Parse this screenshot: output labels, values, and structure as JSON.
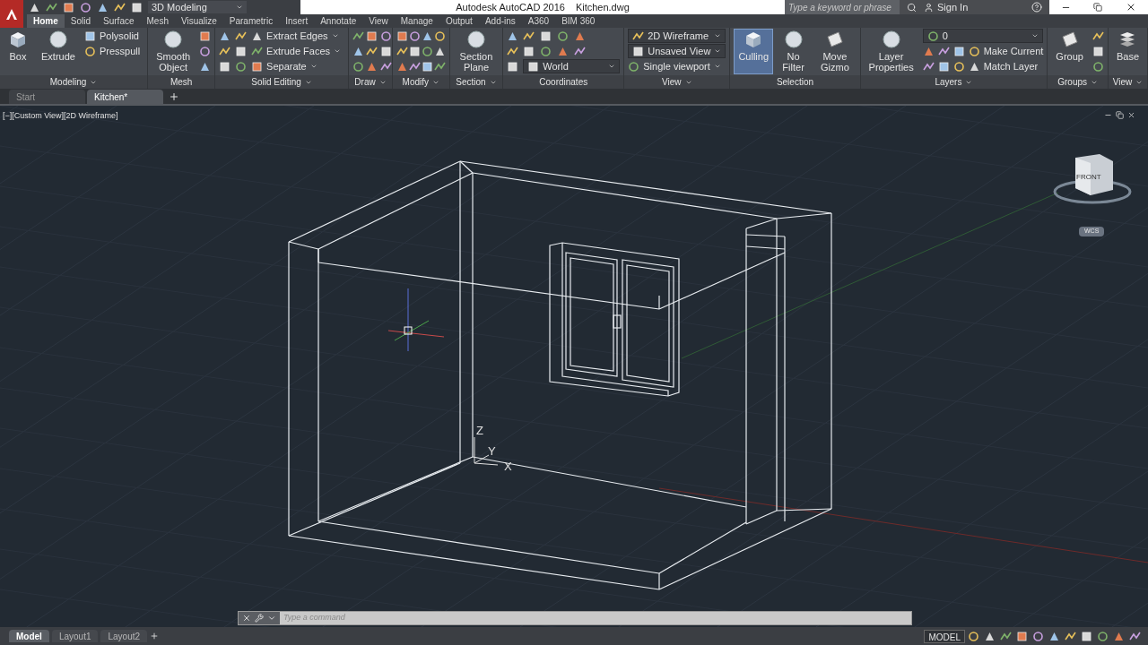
{
  "title_bar": {
    "workspace": "3D Modeling",
    "app_title": "Autodesk AutoCAD 2016",
    "file_name": "Kitchen.dwg",
    "search_placeholder": "Type a keyword or phrase",
    "sign_in": "Sign In"
  },
  "ribbon_tabs": [
    {
      "label": "Home",
      "selected": true
    },
    {
      "label": "Solid",
      "selected": false
    },
    {
      "label": "Surface",
      "selected": false
    },
    {
      "label": "Mesh",
      "selected": false
    },
    {
      "label": "Visualize",
      "selected": false
    },
    {
      "label": "Parametric",
      "selected": false
    },
    {
      "label": "Insert",
      "selected": false
    },
    {
      "label": "Annotate",
      "selected": false
    },
    {
      "label": "View",
      "selected": false
    },
    {
      "label": "Manage",
      "selected": false
    },
    {
      "label": "Output",
      "selected": false
    },
    {
      "label": "Add-ins",
      "selected": false
    },
    {
      "label": "A360",
      "selected": false
    },
    {
      "label": "BIM 360",
      "selected": false
    }
  ],
  "panels": [
    {
      "title": "Modeling",
      "menu": true,
      "items": [
        {
          "kind": "large",
          "label": "Box",
          "selected": false
        },
        {
          "kind": "large",
          "label": "Extrude",
          "selected": false
        },
        {
          "kind": "stack",
          "entries": [
            {
              "kind": "text",
              "label": "Polysolid"
            },
            {
              "kind": "text",
              "label": "Presspull"
            }
          ]
        }
      ]
    },
    {
      "title": "Mesh",
      "menu": false,
      "items": [
        {
          "kind": "large",
          "label": "Smooth Object",
          "selected": false
        },
        {
          "kind": "icon_column"
        }
      ]
    },
    {
      "title": "Solid Editing",
      "menu": true,
      "items": [
        {
          "kind": "icon_column"
        },
        {
          "kind": "icon_column"
        },
        {
          "kind": "stack",
          "entries": [
            {
              "kind": "menu",
              "label": "Extract Edges"
            },
            {
              "kind": "menu",
              "label": "Extrude Faces"
            },
            {
              "kind": "menu",
              "label": "Separate"
            }
          ]
        }
      ]
    },
    {
      "title": "Draw",
      "menu": true,
      "items": [
        {
          "kind": "icon_grid"
        }
      ]
    },
    {
      "title": "Modify",
      "menu": true,
      "items": [
        {
          "kind": "icon_grid"
        },
        {
          "kind": "icon_column"
        }
      ]
    },
    {
      "title": "Section",
      "menu": true,
      "items": [
        {
          "kind": "large",
          "label": "Section Plane",
          "selected": false
        }
      ]
    },
    {
      "title": "Coordinates",
      "menu": false,
      "items": [
        {
          "kind": "icon_column"
        },
        {
          "kind": "stack",
          "entries": [
            {
              "kind": "icons"
            },
            {
              "kind": "icons"
            },
            {
              "kind": "dropdown",
              "label": "World"
            }
          ]
        }
      ]
    },
    {
      "title": "View",
      "menu": true,
      "items": [
        {
          "kind": "stack",
          "entries": [
            {
              "kind": "dropdown",
              "label": "2D Wireframe"
            },
            {
              "kind": "dropdown",
              "label": "Unsaved View"
            },
            {
              "kind": "menu",
              "label": "Single viewport"
            }
          ]
        }
      ]
    },
    {
      "title": "Selection",
      "menu": false,
      "items": [
        {
          "kind": "large",
          "label": "Culling",
          "selected": true
        },
        {
          "kind": "large",
          "label": "No Filter",
          "selected": false
        },
        {
          "kind": "large",
          "label": "Move Gizmo",
          "selected": false
        }
      ]
    },
    {
      "title": "Layers",
      "menu": true,
      "items": [
        {
          "kind": "large",
          "label": "Layer Properties",
          "selected": false
        },
        {
          "kind": "stack",
          "entries": [
            {
              "kind": "dropdown",
              "label": "0"
            },
            {
              "kind": "icon_text",
              "label": "Make Current"
            },
            {
              "kind": "icon_text",
              "label": "Match Layer"
            }
          ]
        }
      ]
    },
    {
      "title": "Groups",
      "menu": true,
      "items": [
        {
          "kind": "large",
          "label": "Group",
          "selected": false
        },
        {
          "kind": "icon_column"
        }
      ]
    },
    {
      "title": "View",
      "menu": true,
      "items": [
        {
          "kind": "large",
          "label": "Base",
          "selected": false
        }
      ]
    }
  ],
  "file_tabs": [
    {
      "label": "Start",
      "selected": false
    },
    {
      "label": "Kitchen*",
      "selected": true
    }
  ],
  "viewport": {
    "label": "[−][Custom View][2D Wireframe]",
    "viewcube_face": "FRONT",
    "wcs": "WCS",
    "axes": [
      "Z",
      "Y",
      "X"
    ]
  },
  "command_line": {
    "placeholder": "Type a command"
  },
  "layout_tabs": [
    {
      "label": "Model",
      "selected": true
    },
    {
      "label": "Layout1",
      "selected": false
    },
    {
      "label": "Layout2",
      "selected": false
    }
  ],
  "status": {
    "space": "MODEL"
  }
}
